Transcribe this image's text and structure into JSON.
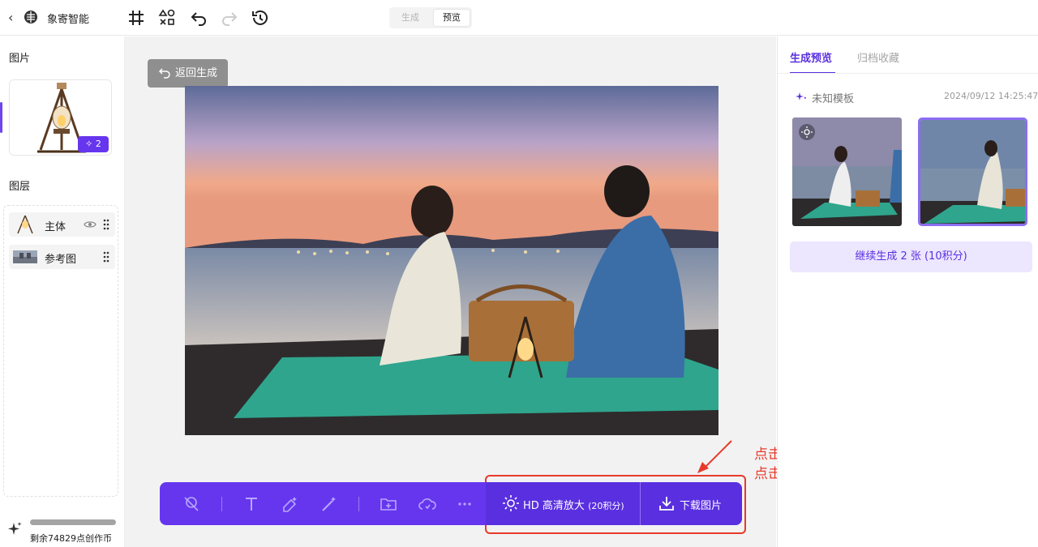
{
  "header": {
    "app_title": "象寄智能",
    "mode_tabs": [
      "生成",
      "预览"
    ],
    "active_mode": "预览"
  },
  "left_panel": {
    "images_title": "图片",
    "image_count": "2",
    "layers_title": "图层",
    "layers": [
      {
        "label": "主体"
      },
      {
        "label": "参考图"
      }
    ],
    "credits_text": "剩余74829点创作币"
  },
  "canvas": {
    "return_label": "返回生成",
    "hd_button_main": "HD 高清放大",
    "hd_button_cost": "(20积分)",
    "download_label": "下载图片"
  },
  "annotation": {
    "line1": "点击 HD 高清放大后,",
    "line2": "点击下载图片"
  },
  "right_panel": {
    "tabs": [
      "生成预览",
      "归档收藏"
    ],
    "active_tab": "生成预览",
    "template_name": "未知模板",
    "timestamp": "2024/09/12 14:25:47",
    "continue_label": "继续生成 2 张 (10积分)"
  },
  "colors": {
    "accent": "#6636ee",
    "annotation_red": "#e8392b",
    "selection_border": "#8b6df2"
  }
}
